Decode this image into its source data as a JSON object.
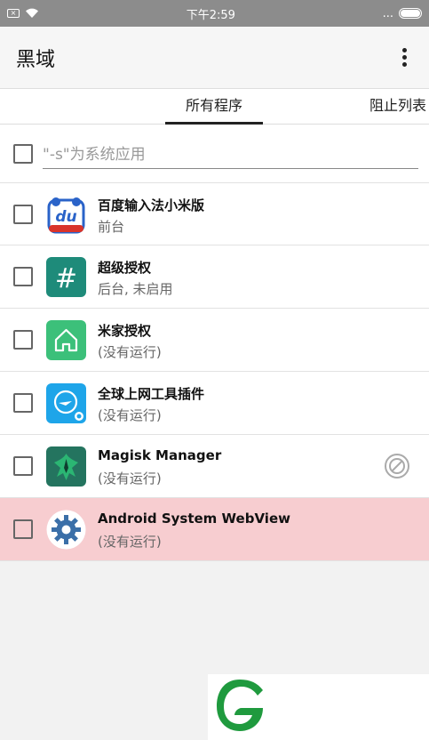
{
  "status_bar": {
    "time": "下午2:59",
    "more": "..."
  },
  "app_bar": {
    "title": "黑域"
  },
  "tabs": [
    {
      "label": "所有程序",
      "active": true
    },
    {
      "label": "阻止列表",
      "active": false
    }
  ],
  "search": {
    "placeholder": "\"-s\"为系统应用",
    "value": ""
  },
  "apps": [
    {
      "name": "百度输入法小米版",
      "status": "前台",
      "icon": "baidu-input-icon",
      "icon_glyph": "du"
    },
    {
      "name": "超级授权",
      "status": "后台, 未启用",
      "icon": "superuser-hash-icon",
      "icon_glyph": "#"
    },
    {
      "name": "米家授权",
      "status": "(没有运行)",
      "icon": "mijia-home-icon"
    },
    {
      "name": "全球上网工具插件",
      "status": "(没有运行)",
      "icon": "global-net-icon"
    },
    {
      "name": "Magisk Manager",
      "status": "(没有运行)",
      "icon": "magisk-icon",
      "blocked": true
    },
    {
      "name": "Android System WebView",
      "status": "(没有运行)",
      "icon": "webview-gear-icon",
      "highlighted": true
    }
  ],
  "colors": {
    "status_bar_bg": "#8c8c8c",
    "highlight_row": "#f7cdd0",
    "superuser_green": "#1e8b7a",
    "mijia_green": "#3cc07a",
    "global_net_blue": "#1ea5e9"
  }
}
